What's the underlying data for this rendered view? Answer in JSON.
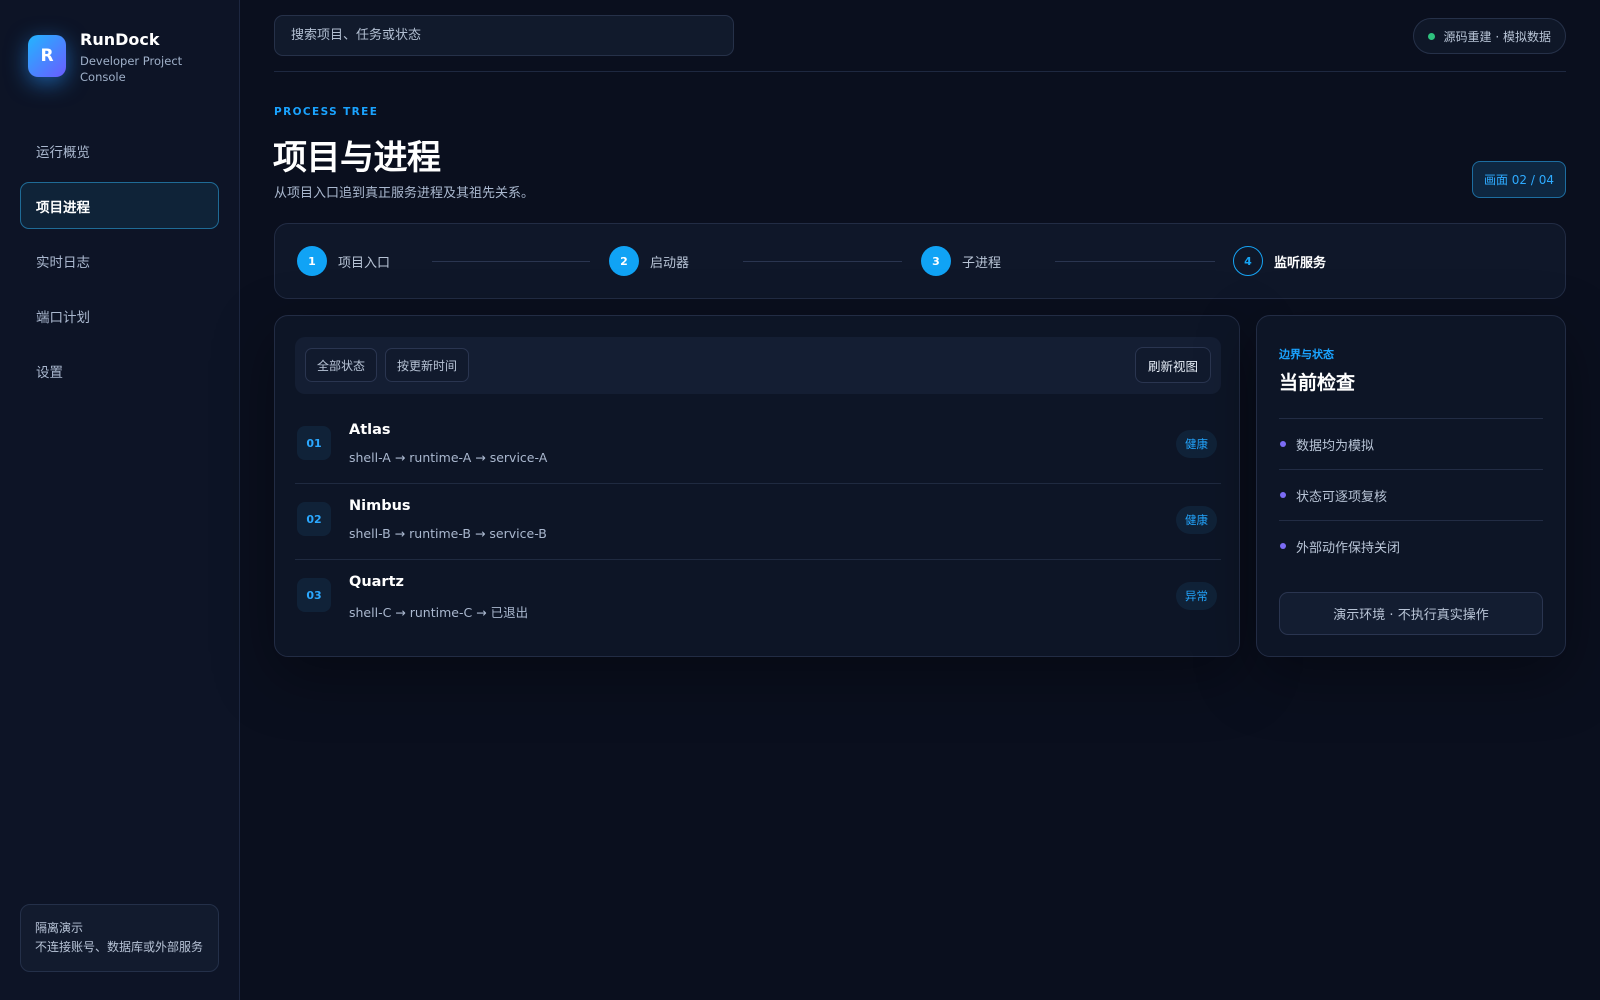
{
  "brand": {
    "logo_letter": "R",
    "name": "RunDock",
    "subtitle": "Developer Project Console"
  },
  "nav": {
    "items": [
      {
        "label": "运行概览",
        "active": false
      },
      {
        "label": "项目进程",
        "active": true
      },
      {
        "label": "实时日志",
        "active": false
      },
      {
        "label": "端口计划",
        "active": false
      },
      {
        "label": "设置",
        "active": false
      }
    ]
  },
  "sidebar_note": {
    "line1": "隔离演示",
    "line2": "不连接账号、数据库或外部服务"
  },
  "search": {
    "placeholder": "搜索项目、任务或状态",
    "value": ""
  },
  "status_pill": {
    "label": "源码重建 · 模拟数据",
    "dot_color": "#2ec27e"
  },
  "page": {
    "eyebrow": "PROCESS TREE",
    "title": "项目与进程",
    "subtitle": "从项目入口追到真正服务进程及其祖先关系。",
    "screen_badge": "画面 02 / 04"
  },
  "stepper": {
    "steps": [
      {
        "num": "1",
        "label": "项目入口"
      },
      {
        "num": "2",
        "label": "启动器"
      },
      {
        "num": "3",
        "label": "子进程"
      },
      {
        "num": "4",
        "label": "监听服务"
      }
    ]
  },
  "toolbar": {
    "filter_all": "全部状态",
    "sort_updated": "按更新时间",
    "refresh": "刷新视图"
  },
  "projects": [
    {
      "num": "01",
      "name": "Atlas",
      "path": "shell-A → runtime-A → service-A",
      "status": "健康"
    },
    {
      "num": "02",
      "name": "Nimbus",
      "path": "shell-B → runtime-B → service-B",
      "status": "健康"
    },
    {
      "num": "03",
      "name": "Quartz",
      "path": "shell-C → runtime-C → 已退出",
      "status": "异常"
    }
  ],
  "side_panel": {
    "eyebrow": "边界与状态",
    "title": "当前检查",
    "items": [
      "数据均为模拟",
      "状态可逐项复核",
      "外部动作保持关闭"
    ],
    "action": "演示环境 · 不执行真实操作"
  },
  "colors": {
    "accent": "#10a3f5",
    "bullet": "#7c6cf5",
    "background": "#0a0f1e"
  }
}
